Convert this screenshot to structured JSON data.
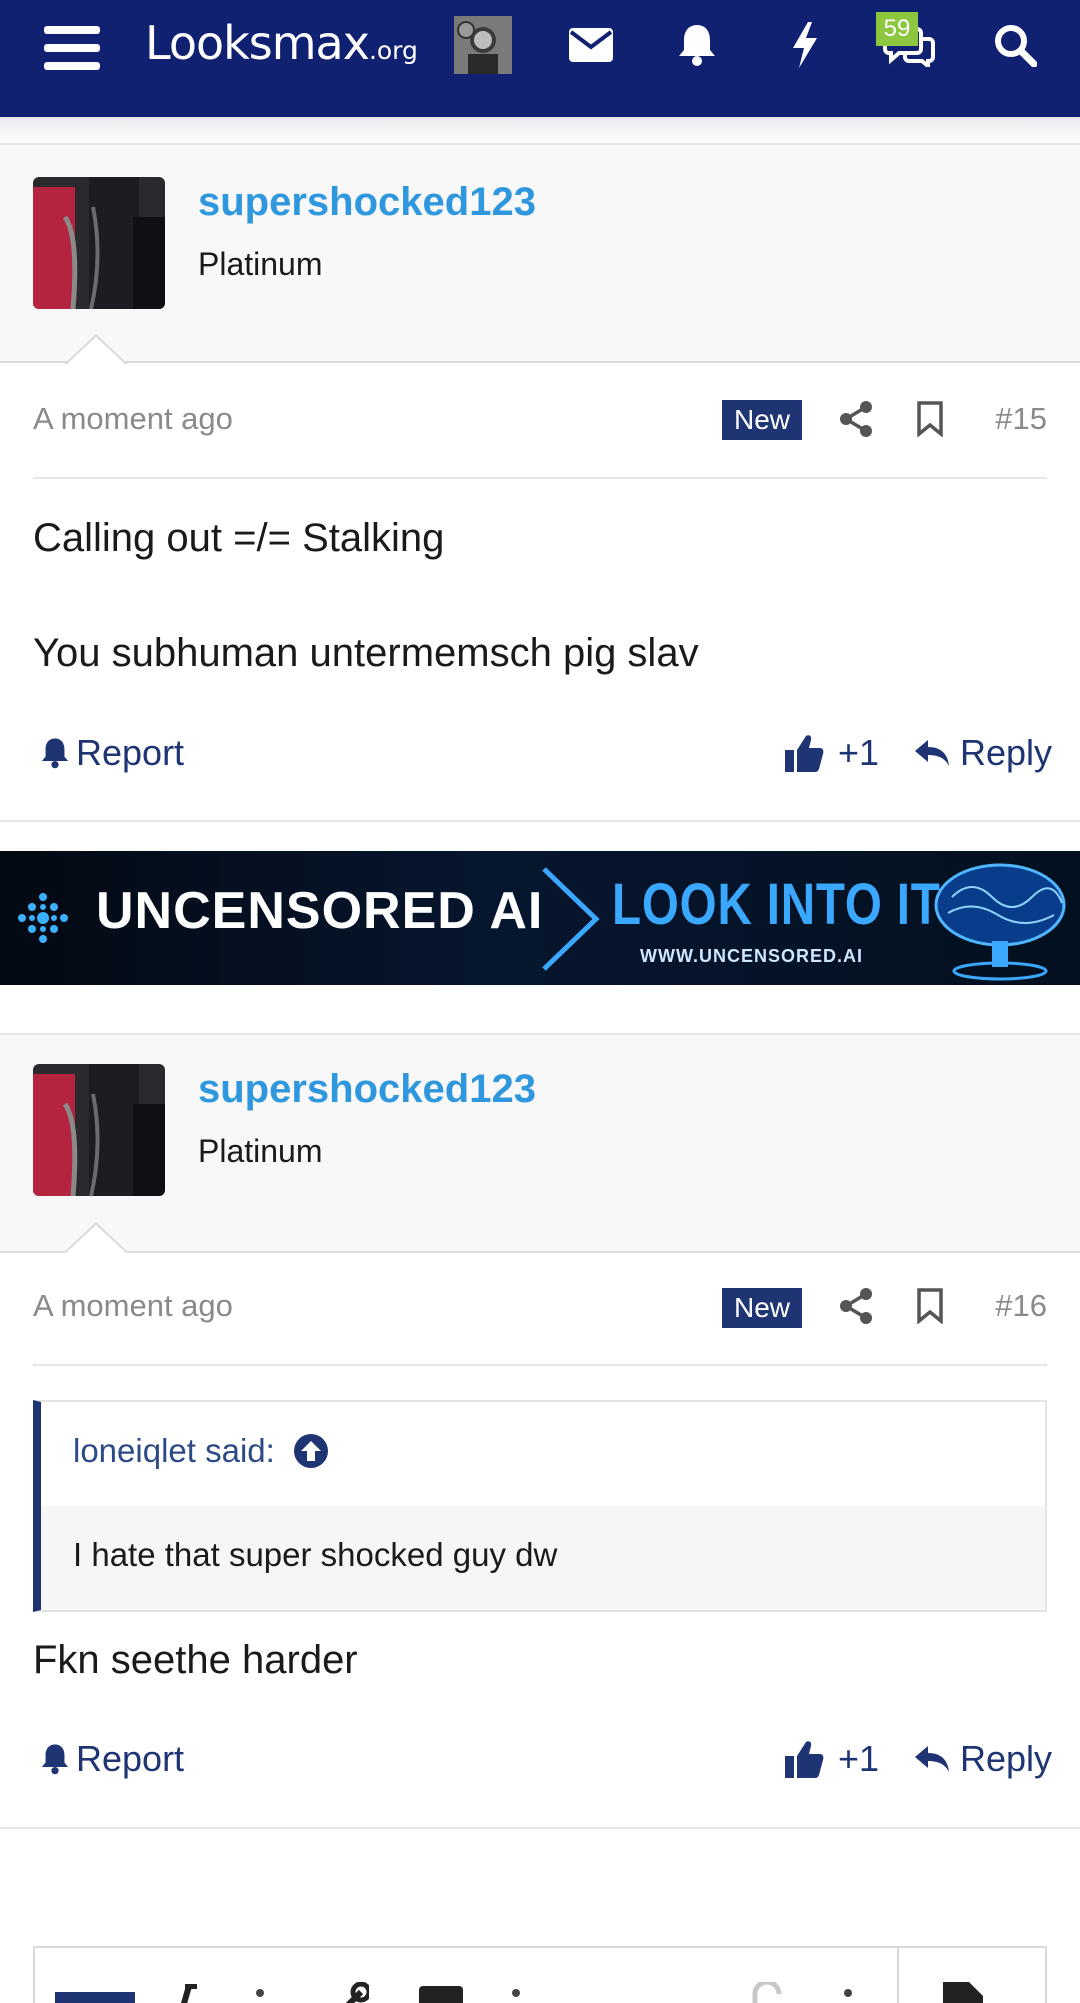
{
  "app": {
    "logo_main": "Looksmax",
    "logo_sub": ".org",
    "chat_badge": "59"
  },
  "icons": {
    "menu": "hamburger-icon",
    "mail": "envelope-icon",
    "alerts": "bell-icon",
    "whats_new": "bolt-icon",
    "conversations": "chat-icon",
    "search": "search-icon",
    "share": "share-icon",
    "bookmark": "bookmark-icon",
    "like": "thumbs-up-icon",
    "reply": "reply-icon",
    "report": "bell-icon"
  },
  "colors": {
    "nav_bg": "#112172",
    "username": "#2f97dd",
    "accent": "#1e3473",
    "badge": "#8dc63f"
  },
  "posts": [
    {
      "username": "supershocked123",
      "user_title": "Platinum",
      "time": "A moment ago",
      "new_label": "New",
      "number": "#15",
      "lines": [
        "Calling out =/= Stalking",
        "You subhuman untermemsch pig slav"
      ],
      "report": "Report",
      "likes": "+1",
      "reply": "Reply"
    },
    {
      "username": "supershocked123",
      "user_title": "Platinum",
      "time": "A moment ago",
      "new_label": "New",
      "number": "#16",
      "quote": {
        "author": "loneiqlet said:",
        "text": "I hate that super shocked guy dw"
      },
      "lines": [
        "Fkn seethe harder"
      ],
      "report": "Report",
      "likes": "+1",
      "reply": "Reply"
    }
  ],
  "ad": {
    "left_text": "UNCENSORED AI",
    "right_text": "LOOK INTO IT",
    "url": "WWW.UNCENSORED.AI"
  }
}
